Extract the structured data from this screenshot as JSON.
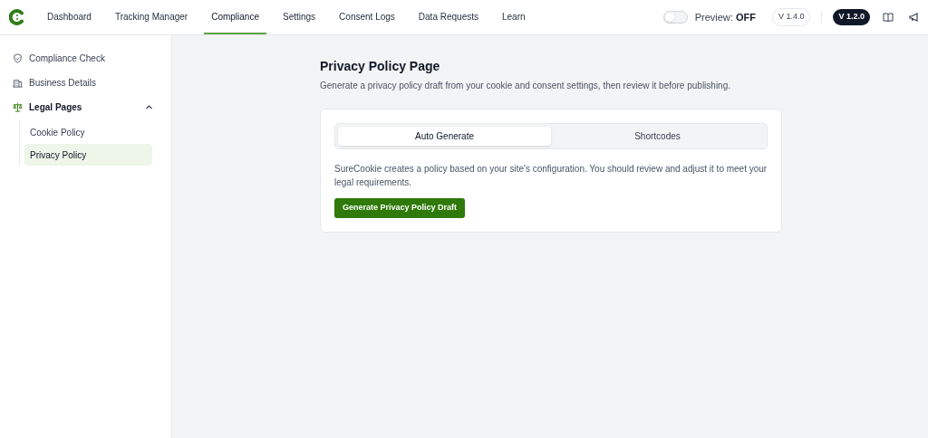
{
  "nav": {
    "tabs": [
      {
        "label": "Dashboard",
        "selected": false
      },
      {
        "label": "Tracking Manager",
        "selected": false
      },
      {
        "label": "Compliance",
        "selected": true
      },
      {
        "label": "Settings",
        "selected": false
      },
      {
        "label": "Consent Logs",
        "selected": false
      },
      {
        "label": "Data Requests",
        "selected": false
      },
      {
        "label": "Learn",
        "selected": false
      }
    ],
    "preview": {
      "label": "Preview:",
      "value": "OFF",
      "on": false
    },
    "versions": [
      {
        "label": "V 1.4.0",
        "selected": false
      },
      {
        "label": "V 1.2.0",
        "selected": true
      }
    ]
  },
  "sidebar": {
    "items": [
      {
        "label": "Compliance Check",
        "selected": false
      },
      {
        "label": "Business Details",
        "selected": false
      },
      {
        "label": "Legal Pages",
        "selected": false,
        "expanded": true,
        "children": [
          {
            "label": "Cookie Policy",
            "selected": false
          },
          {
            "label": "Privacy Policy",
            "selected": true
          }
        ]
      }
    ]
  },
  "page": {
    "title": "Privacy Policy Page",
    "subtitle": "Generate a privacy policy draft from your cookie and consent settings, then review it before publishing.",
    "tabs": [
      {
        "label": "Auto Generate",
        "selected": true
      },
      {
        "label": "Shortcodes",
        "selected": false
      }
    ],
    "description": "SureCookie creates a policy based on your site's configuration. You should review and adjust it to meet your legal requirements.",
    "button": "Generate Privacy Policy Draft"
  }
}
